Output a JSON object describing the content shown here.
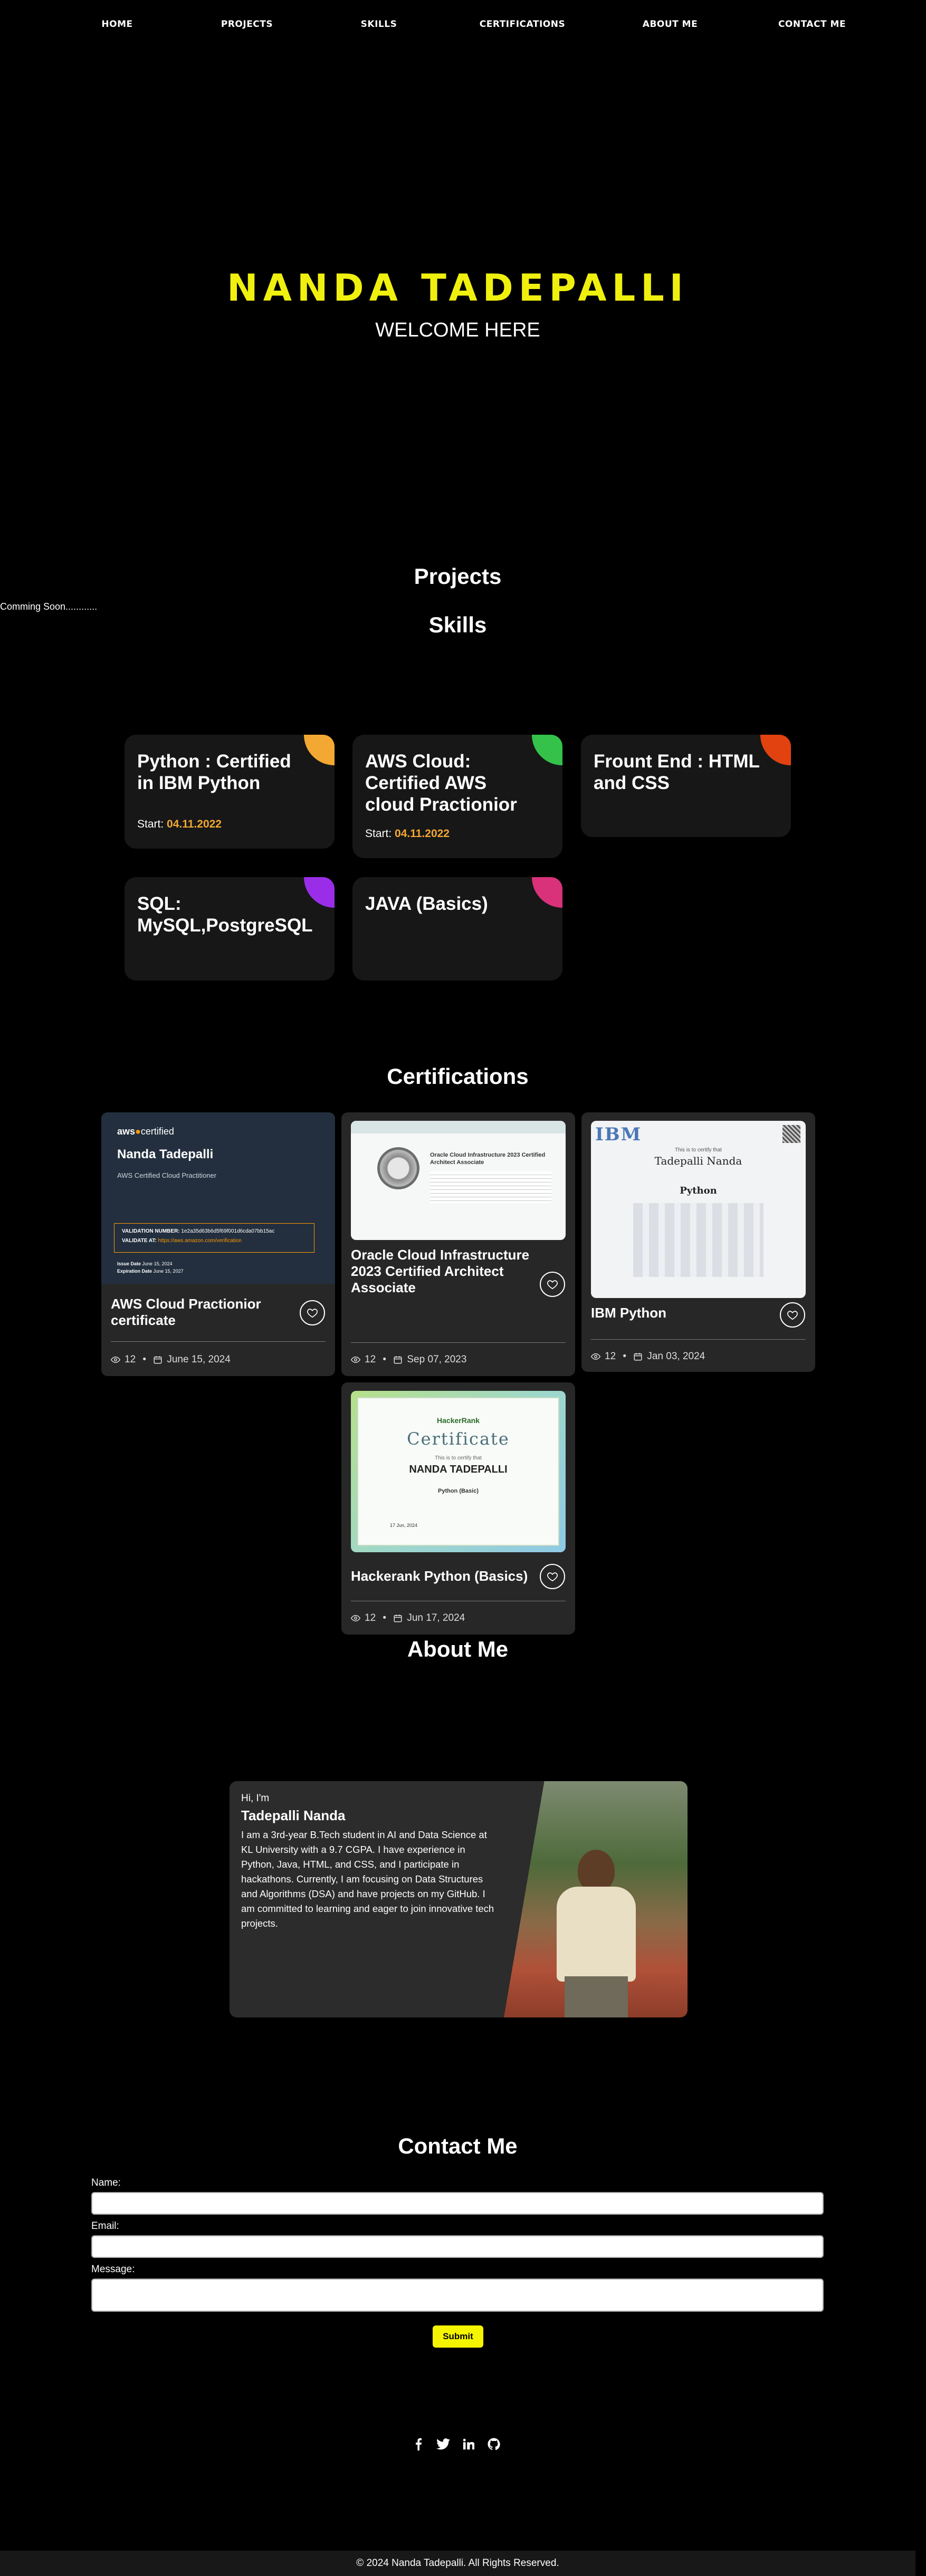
{
  "nav": {
    "items": [
      {
        "label": "HOME"
      },
      {
        "label": "PROJECTS"
      },
      {
        "label": "SKILLS"
      },
      {
        "label": "CERTIFICATIONS"
      },
      {
        "label": "ABOUT ME"
      },
      {
        "label": "CONTACT ME"
      }
    ]
  },
  "hero": {
    "title": "NANDA TADEPALLI",
    "subtitle": "WELCOME HERE"
  },
  "projects": {
    "title": "Projects",
    "coming_soon": "Comming Soon............"
  },
  "skills": {
    "title": "Skills",
    "start_prefix": "Start:",
    "items": [
      {
        "title": "Python : Certified in IBM Python",
        "start": "04.11.2022",
        "accent": "#f3a833"
      },
      {
        "title": "AWS Cloud: Certified AWS cloud Practionior",
        "start": "04.11.2022",
        "accent": "#34c24a"
      },
      {
        "title": "Frount End : HTML and CSS",
        "accent": "#e2420f"
      },
      {
        "title": "SQL: MySQL,PostgreSQL",
        "accent": "#9a2ee8"
      },
      {
        "title": "JAVA (Basics)",
        "accent": "#d9327a"
      }
    ]
  },
  "certifications": {
    "title": "Certifications",
    "items": [
      {
        "name": "AWS Cloud Practionior certificate",
        "views": "12",
        "date": "June 15, 2024",
        "image": {
          "brand": "aws",
          "brand_suffix": "certified",
          "holder": "Nanda Tadepalli",
          "cert": "AWS Certified Cloud Practitioner",
          "validation_label": "VALIDATION NUMBER:",
          "validation_number": "1e2a35d63b6d5f69f001d6cda07bb15ac",
          "validate_label": "VALIDATE AT:",
          "validate_url": "https://aws.amazon.com/verification",
          "issue_label": "Issue Date",
          "issue_date": "June 15, 2024",
          "expiration_label": "Expiration Date",
          "expiration_date": "June 15, 2027"
        }
      },
      {
        "name": "Oracle Cloud Infrastructure 2023 Certified Architect Associate",
        "views": "12",
        "date": "Sep 07, 2023",
        "image": {
          "heading": "Oracle Cloud Infrastructure 2023 Certified Architect Associate"
        }
      },
      {
        "name": "IBM Python",
        "views": "12",
        "date": "Jan 03, 2024",
        "image": {
          "logo": "IBM",
          "intro": "This is to certify that",
          "holder": "Tadepalli Nanda",
          "course": "Python"
        }
      },
      {
        "name": "Hackerank Python (Basics)",
        "views": "12",
        "date": "Jun 17, 2024",
        "image": {
          "brand": "HackerRank",
          "word": "Certificate",
          "intro": "This is to certify that",
          "holder": "NANDA TADEPALLI",
          "course": "Python (Basic)",
          "date": "17 Jun, 2024"
        }
      }
    ]
  },
  "about": {
    "title": "About Me",
    "greeting": "Hi, I'm",
    "name": "Tadepalli Nanda",
    "bio": "I am a 3rd-year B.Tech student in AI and Data Science at KL University with a 9.7 CGPA. I have experience in Python, Java, HTML, and CSS, and I participate in hackathons. Currently, I am focusing on Data Structures and Algorithms (DSA) and have projects on my GitHub. I am committed to learning and eager to join innovative tech projects."
  },
  "contact": {
    "title": "Contact Me",
    "name_label": "Name:",
    "email_label": "Email:",
    "message_label": "Message:",
    "submit_label": "Submit"
  },
  "social": {
    "icons": [
      "facebook-icon",
      "twitter-icon",
      "linkedin-icon",
      "github-icon"
    ]
  },
  "footer": {
    "text": "© 2024 Nanda Tadepalli. All Rights Reserved."
  }
}
